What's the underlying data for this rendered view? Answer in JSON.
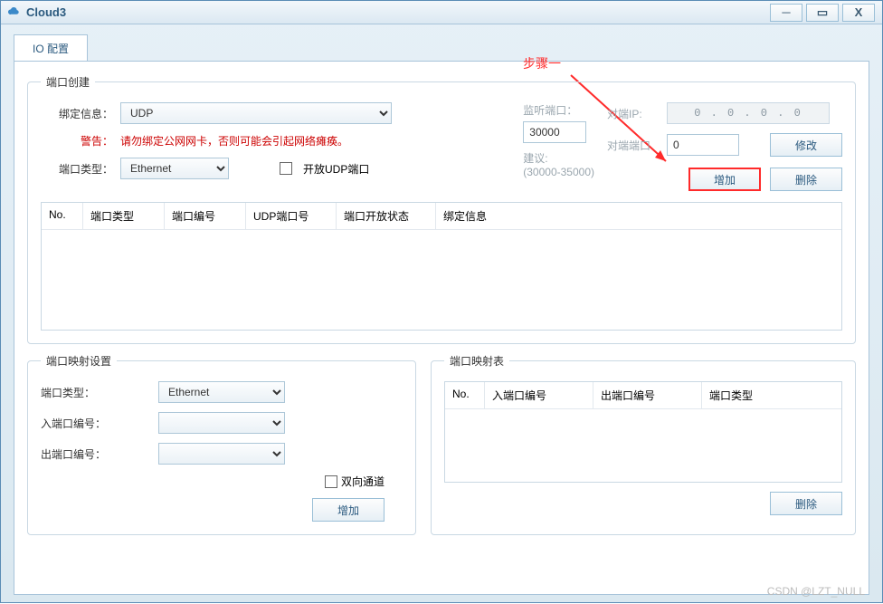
{
  "window": {
    "title": "Cloud3"
  },
  "tabs": {
    "io_config": "IO 配置"
  },
  "annotation": {
    "step1": "步骤一"
  },
  "fieldsets": {
    "port_create": "端口创建",
    "port_map_setting": "端口映射设置",
    "port_map_table": "端口映射表"
  },
  "labels": {
    "bind_info": "绑定信息：",
    "warning": "警告：",
    "port_type": "端口类型：",
    "open_udp": "开放UDP端口",
    "listen_port": "监听端口：",
    "suggest": "建议:",
    "suggest_range": "(30000-35000)",
    "peer_ip": "对端IP:",
    "peer_port": "对端端口",
    "in_port_no": "入端口编号：",
    "out_port_no": "出端口编号：",
    "bidir": "双向通道"
  },
  "warning_text": "请勿绑定公网网卡，否则可能会引起网络瘫痪。",
  "selects": {
    "bind": "UDP",
    "port_type": "Ethernet",
    "map_port_type": "Ethernet"
  },
  "inputs": {
    "listen_port": "30000",
    "peer_port": "0",
    "ip": "0 . 0 . 0 . 0"
  },
  "buttons": {
    "modify": "修改",
    "add": "增加",
    "delete": "删除",
    "add2": "增加",
    "delete2": "删除"
  },
  "table1": {
    "cols": {
      "no": "No.",
      "ptype": "端口类型",
      "pno": "端口编号",
      "udpno": "UDP端口号",
      "open": "端口开放状态",
      "bind": "绑定信息"
    }
  },
  "table2": {
    "cols": {
      "no": "No.",
      "in": "入端口编号",
      "out": "出端口编号",
      "type": "端口类型"
    }
  },
  "watermark": "CSDN @LZT_NULL"
}
